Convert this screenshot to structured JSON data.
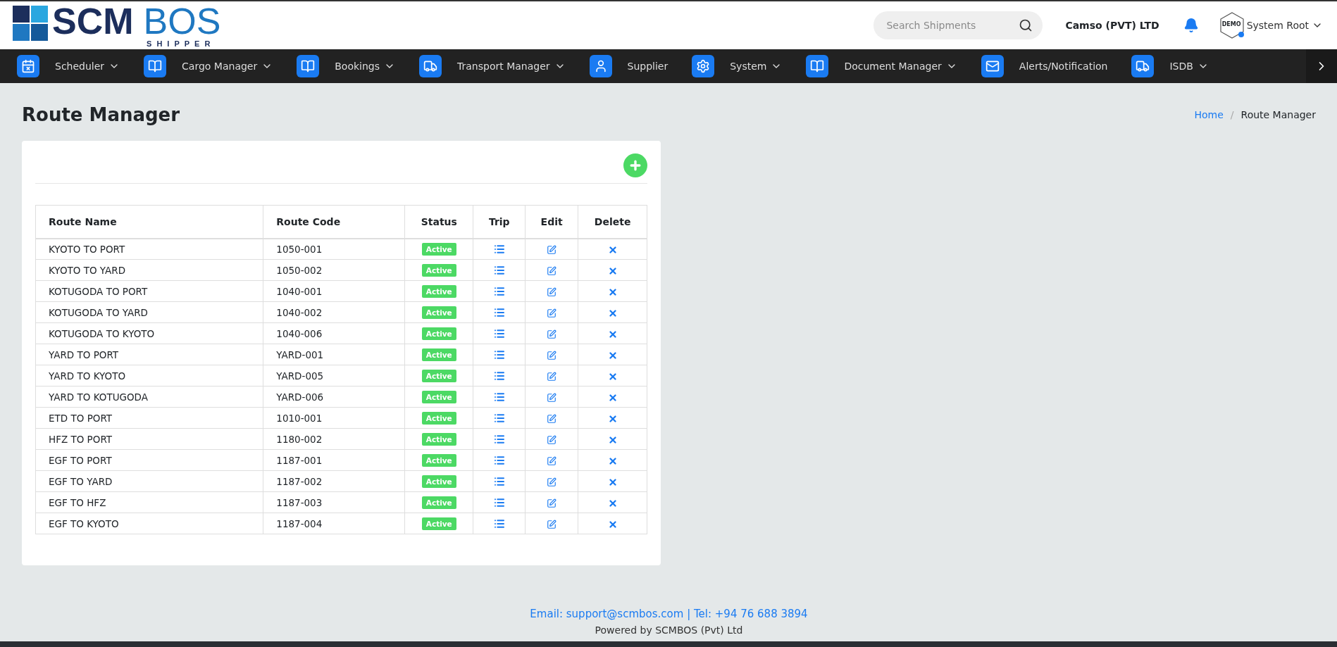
{
  "header": {
    "logo": {
      "main": "SCM",
      "accent": "BOS",
      "sub": "SHIPPER"
    },
    "search": {
      "placeholder": "Search Shipments"
    },
    "company": "Camso (PVT) LTD",
    "avatar_badge": "DEMO",
    "user": "System Root"
  },
  "nav": [
    {
      "label": "Scheduler",
      "kind": "calendar",
      "dropdown": true
    },
    {
      "label": "Cargo Manager",
      "kind": "book",
      "dropdown": true
    },
    {
      "label": "Bookings",
      "kind": "book",
      "dropdown": true
    },
    {
      "label": "Transport Manager",
      "kind": "truck",
      "dropdown": true
    },
    {
      "label": "Supplier",
      "kind": "user",
      "dropdown": false
    },
    {
      "label": "System",
      "kind": "gears",
      "dropdown": true
    },
    {
      "label": "Document Manager",
      "kind": "book",
      "dropdown": true
    },
    {
      "label": "Alerts/Notification",
      "kind": "mail",
      "dropdown": false
    },
    {
      "label": "ISDB",
      "kind": "truck",
      "dropdown": true
    }
  ],
  "page_title": "Route Manager",
  "breadcrumb": [
    {
      "label": "Home",
      "link": true
    },
    {
      "label": "Route Manager",
      "link": false
    }
  ],
  "breadcrumb_separator": "/",
  "table": {
    "columns": [
      "Route Name",
      "Route Code",
      "Status",
      "Trip",
      "Edit",
      "Delete"
    ],
    "rows": [
      {
        "name": "KYOTO TO PORT",
        "code": "1050-001",
        "status": "Active"
      },
      {
        "name": "KYOTO TO YARD",
        "code": "1050-002",
        "status": "Active"
      },
      {
        "name": "KOTUGODA TO PORT",
        "code": "1040-001",
        "status": "Active"
      },
      {
        "name": "KOTUGODA TO YARD",
        "code": "1040-002",
        "status": "Active"
      },
      {
        "name": "KOTUGODA TO KYOTO",
        "code": "1040-006",
        "status": "Active"
      },
      {
        "name": "YARD TO PORT",
        "code": "YARD-001",
        "status": "Active"
      },
      {
        "name": "YARD TO KYOTO",
        "code": "YARD-005",
        "status": "Active"
      },
      {
        "name": "YARD TO KOTUGODA",
        "code": "YARD-006",
        "status": "Active"
      },
      {
        "name": "ETD TO PORT",
        "code": "1010-001",
        "status": "Active"
      },
      {
        "name": "HFZ TO PORT",
        "code": "1180-002",
        "status": "Active"
      },
      {
        "name": "EGF TO PORT",
        "code": "1187-001",
        "status": "Active"
      },
      {
        "name": "EGF TO YARD",
        "code": "1187-002",
        "status": "Active"
      },
      {
        "name": "EGF TO HFZ",
        "code": "1187-003",
        "status": "Active"
      },
      {
        "name": "EGF TO KYOTO",
        "code": "1187-004",
        "status": "Active"
      }
    ]
  },
  "footer": {
    "contact": "Email: support@scmbos.com | Tel: +94 76 688 3894",
    "powered": "Powered by SCMBOS (Pvt) Ltd"
  }
}
